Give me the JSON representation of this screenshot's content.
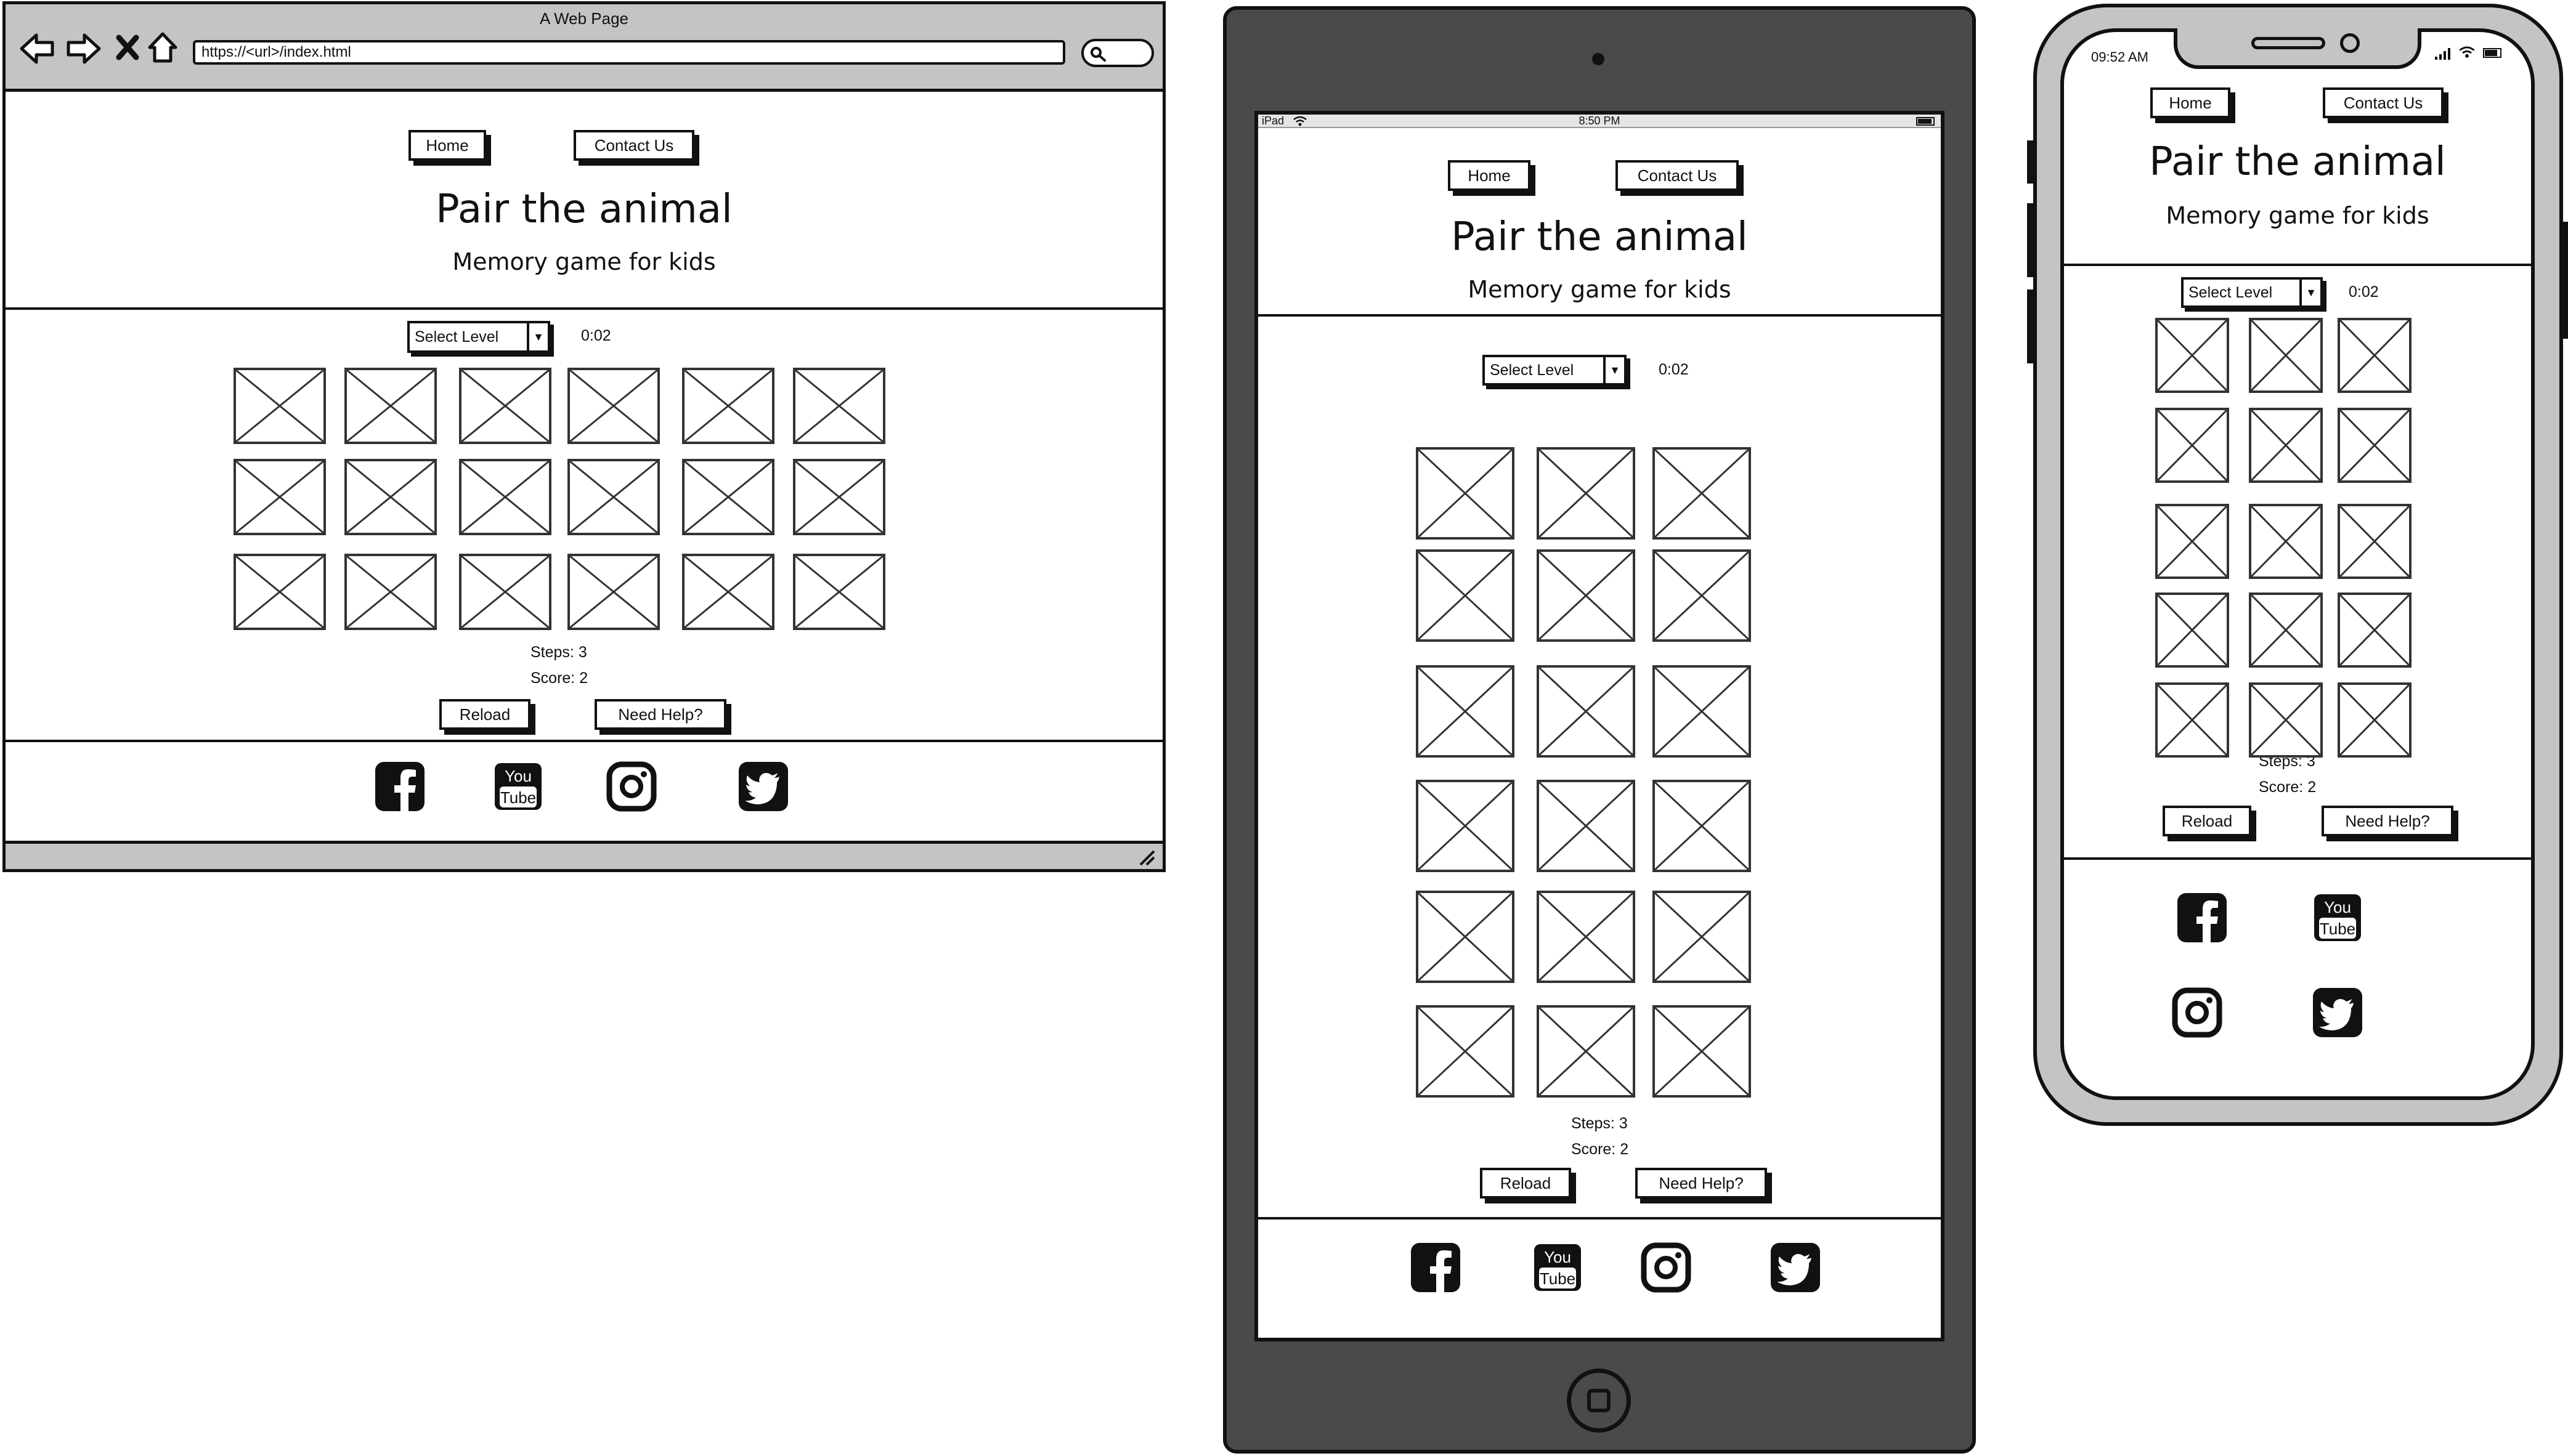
{
  "browser": {
    "window_title": "A Web Page",
    "url": "https://<url>/index.html"
  },
  "tablet": {
    "carrier": "iPad",
    "time": "8:50 PM"
  },
  "phone": {
    "time": "09:52 AM"
  },
  "site": {
    "nav_home": "Home",
    "nav_contact": "Contact Us",
    "title": "Pair the animal",
    "subtitle": "Memory game for kids",
    "level_select": "Select Level",
    "timer": "0:02",
    "steps": "Steps: 3",
    "score": "Score: 2",
    "reload": "Reload",
    "help": "Need Help?",
    "social_icons": [
      "facebook-icon",
      "youtube-icon",
      "instagram-icon",
      "twitter-icon"
    ],
    "youtube_top": "You",
    "youtube_bottom": "Tube"
  },
  "colors": {
    "frame_grey": "#c4c4c4",
    "tablet_body": "#4a4a4a",
    "ink": "#111111"
  }
}
